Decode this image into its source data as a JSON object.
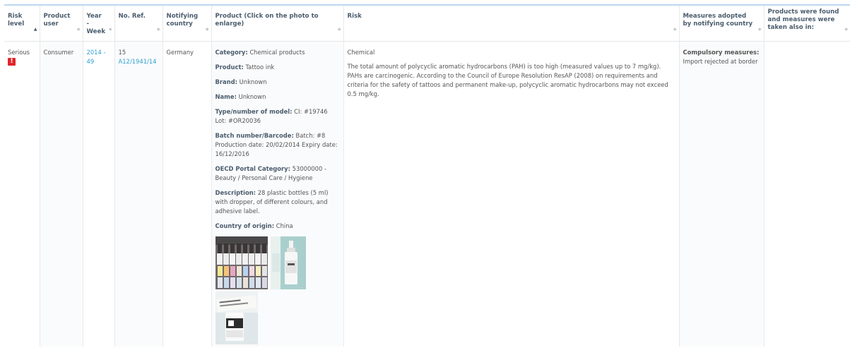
{
  "columns": [
    {
      "label": "Risk level",
      "sort": "▲"
    },
    {
      "label": "Product user",
      "sort": "◆"
    },
    {
      "label": "Year - Week",
      "sort": "◆"
    },
    {
      "label": "No. Ref.",
      "sort": "◆"
    },
    {
      "label": "Notifying country",
      "sort": "◆"
    },
    {
      "label": "Product (Click on the photo to enlarge)",
      "sort": "◆"
    },
    {
      "label": "Risk",
      "sort": "◆"
    },
    {
      "label": "Measures adopted by notifying country",
      "sort": "◆"
    },
    {
      "label": "Products were found and measures were taken also in:",
      "sort": "◆"
    }
  ],
  "row": {
    "risk_level": "Serious",
    "risk_badge": "!",
    "product_user": "Consumer",
    "year_week": "2014 - 49",
    "ref_number": "15",
    "ref_link": "A12/1941/14",
    "notifying_country": "Germany",
    "product": {
      "category_label": "Category:",
      "category_value": " Chemical products",
      "product_label": "Product:",
      "product_value": " Tattoo ink",
      "brand_label": "Brand:",
      "brand_value": " Unknown",
      "name_label": "Name:",
      "name_value": " Unknown",
      "model_label": "Type/number of model:",
      "model_value": " CI: #19746 Lot: #OR20036",
      "batch_label": "Batch number/Barcode:",
      "batch_value": " Batch: #8 Production date: 20/02/2014 Expiry date: 16/12/2016",
      "oecd_label": "OECD Portal Category:",
      "oecd_value": " 53000000 - Beauty / Personal Care / Hygiene",
      "description_label": "Description:",
      "description_value": " 28 plastic bottles (5 ml) with dropper, of different colours, and adhesive label.",
      "origin_label": "Country of origin:",
      "origin_value": " China"
    },
    "risk": {
      "type": "Chemical",
      "text": "The total amount of polycyclic aromatic hydrocarbons (PAH) is too high (measured values up to 7 mg/kg). PAHs are carcinogenic. According to the Council of Europe Resolution ResAP (2008) on requirements and criteria for the safety of tattoos and permanent make-up, polycyclic aromatic hydrocarbons may not exceed 0.5 mg/kg."
    },
    "measures": {
      "label": "Compulsory measures:",
      "value": " Import rejected at border"
    },
    "also_in": ""
  },
  "colors": {
    "accent_link": "#32a0d2",
    "badge_red": "#e0262b",
    "header_text": "#4b5d6e"
  }
}
